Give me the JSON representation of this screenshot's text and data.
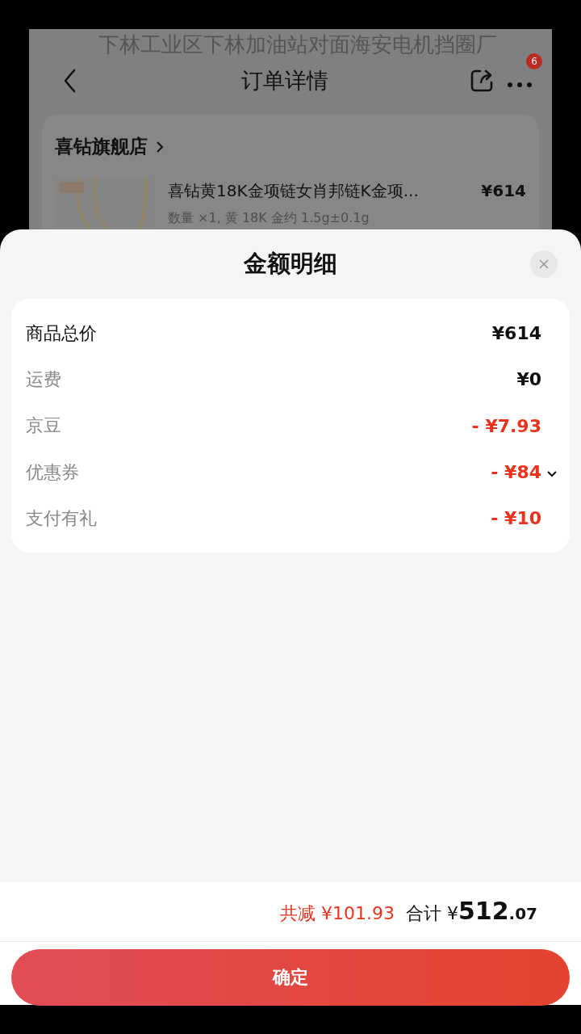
{
  "background_page": {
    "address": "下林工业区下林加油站对面海安电机挡圈厂",
    "nav": {
      "title": "订单详情",
      "badge": "6"
    },
    "order": {
      "store": "喜钻旗舰店",
      "product": {
        "kind": "picture",
        "title": "喜钻黄18K金项链女肖邦链K金项...",
        "price": "¥614",
        "spec": "数量 ×1, 黄 18K 金约 1.5g±0.1g"
      }
    }
  },
  "sheet": {
    "title": "金额明细",
    "rows": [
      {
        "label": "商品总价",
        "value": "¥614",
        "kind": "subtotal"
      },
      {
        "label": "运费",
        "value": "¥0",
        "kind": "charge"
      },
      {
        "label": "京豆",
        "value": "- ¥7.93",
        "kind": "discount"
      },
      {
        "label": "优惠券",
        "value": "- ¥84",
        "kind": "discount",
        "expanded": false
      },
      {
        "label": "支付有礼",
        "value": "- ¥10",
        "kind": "discount"
      }
    ]
  },
  "footer": {
    "saved": "共减 ¥101.93",
    "total": {
      "label": "合计",
      "currency": "¥",
      "integer": "512",
      "decimal": ".07"
    },
    "confirm": "确定"
  }
}
